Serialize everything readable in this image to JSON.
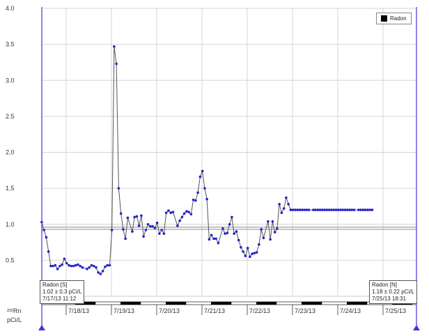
{
  "chart_data": {
    "type": "line",
    "ylim": [
      0,
      4.0
    ],
    "y_ticks": [
      "4.0",
      "3.5",
      "3.0",
      "2.5",
      "2.0",
      "1.5",
      "1.0",
      "0.5"
    ],
    "x_ticks": [
      "7/18/13",
      "7/19/13",
      "7/20/13",
      "7/21/13",
      "7/22/13",
      "7/23/13",
      "7/24/13",
      "7/25/13"
    ],
    "grid": true,
    "legend_position": "top-right",
    "y_unit_lines": [
      "²²²Rn",
      "pCi/L"
    ],
    "series": [
      {
        "name": "Radon",
        "color": "#2222cc",
        "line_color": "#555555",
        "x": [
          0.06,
          0.11,
          0.16,
          0.21,
          0.26,
          0.31,
          0.36,
          0.41,
          0.46,
          0.51,
          0.56,
          0.61,
          0.66,
          0.71,
          0.76,
          0.81,
          0.86,
          0.91,
          0.96,
          1.06,
          1.11,
          1.16,
          1.21,
          1.26,
          1.31,
          1.36,
          1.41,
          1.46,
          1.51,
          1.56,
          1.61,
          1.66,
          1.71,
          1.76,
          1.81,
          1.86,
          1.91,
          1.96,
          2.06,
          2.11,
          2.16,
          2.21,
          2.26,
          2.31,
          2.36,
          2.41,
          2.46,
          2.51,
          2.56,
          2.61,
          2.66,
          2.71,
          2.76,
          2.81,
          2.86,
          2.91,
          2.96,
          3.06,
          3.11,
          3.16,
          3.21,
          3.26,
          3.31,
          3.36,
          3.41,
          3.46,
          3.51,
          3.56,
          3.61,
          3.66,
          3.71,
          3.76,
          3.81,
          3.86,
          3.91,
          3.96,
          4.06,
          4.11,
          4.16,
          4.21,
          4.26,
          4.31,
          4.36,
          4.41,
          4.46,
          4.51,
          4.56,
          4.61,
          4.66,
          4.71,
          4.76,
          4.81,
          4.86,
          4.91,
          4.96,
          5.06,
          5.11,
          5.16,
          5.21,
          5.26,
          5.31,
          5.36,
          5.41,
          5.46,
          5.51,
          5.56,
          5.61,
          5.66,
          5.71,
          5.76,
          5.81,
          5.86,
          5.91,
          5.96,
          6.06,
          6.11,
          6.16,
          6.21,
          6.26,
          6.31,
          6.36,
          6.41,
          6.46,
          6.51,
          6.56,
          6.61,
          6.66,
          6.71,
          6.76,
          6.81,
          6.86,
          6.91,
          6.96,
          7.06,
          7.11,
          7.16,
          7.21,
          7.26,
          7.31,
          7.36
        ],
        "y": [
          1.03,
          0.92,
          0.82,
          0.62,
          0.42,
          0.42,
          0.43,
          0.38,
          0.42,
          0.44,
          0.52,
          0.46,
          0.43,
          0.42,
          0.42,
          0.43,
          0.44,
          0.42,
          0.4,
          0.38,
          0.4,
          0.43,
          0.42,
          0.4,
          0.33,
          0.31,
          0.35,
          0.41,
          0.43,
          0.43,
          0.92,
          3.47,
          3.23,
          1.5,
          1.15,
          0.93,
          0.8,
          1.09,
          0.9,
          1.1,
          1.11,
          0.98,
          1.12,
          0.83,
          0.92,
          1.0,
          0.97,
          0.97,
          0.95,
          1.02,
          0.87,
          0.92,
          0.87,
          1.16,
          1.19,
          1.16,
          1.17,
          0.98,
          1.05,
          1.1,
          1.15,
          1.18,
          1.17,
          1.14,
          1.34,
          1.33,
          1.44,
          1.66,
          1.74,
          1.5,
          1.35,
          0.79,
          0.85,
          0.8,
          0.8,
          0.74,
          0.94,
          0.87,
          0.88,
          1.0,
          1.1,
          0.87,
          0.9,
          0.78,
          0.68,
          0.62,
          0.56,
          0.67,
          0.55,
          0.59,
          0.6,
          0.61,
          0.72,
          0.93,
          0.81,
          1.04,
          0.79,
          1.04,
          0.89,
          0.94,
          1.28,
          1.16,
          1.22,
          1.37,
          1.28,
          1.2,
          1.2,
          1.2,
          1.2,
          1.2,
          1.2,
          1.2,
          1.2,
          1.2,
          1.2,
          1.2,
          1.2,
          1.2,
          1.2,
          1.2,
          1.2,
          1.2,
          1.2,
          1.2,
          1.2,
          1.2,
          1.2,
          1.2,
          1.2,
          1.2,
          1.2,
          1.2,
          1.2,
          1.2,
          1.2,
          1.2,
          1.2,
          1.2,
          1.2,
          1.2
        ]
      }
    ],
    "reference_lines": [
      0.93,
      0.96
    ],
    "readouts": {
      "left": [
        "Radon [S]",
        "1.02 ± 0.3 pCi/L",
        "7/17/13 11:12"
      ],
      "right": [
        "Radon [N]",
        "1.18 ± 0.22 pCi/L",
        "7/25/13 18:31"
      ]
    }
  },
  "legend": {
    "label": "Radon",
    "swatch_color": "#000000"
  }
}
